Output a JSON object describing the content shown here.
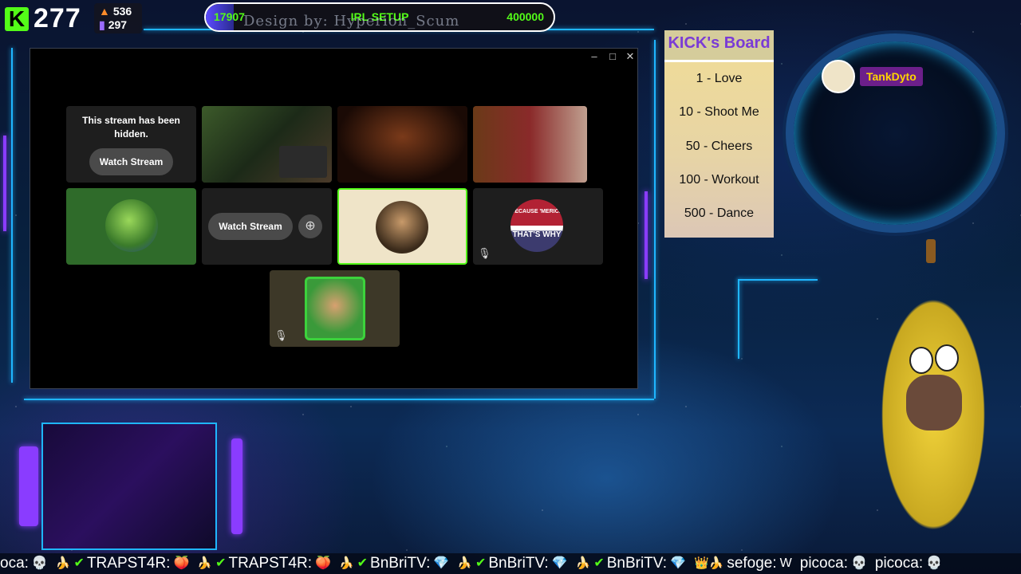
{
  "stats": {
    "viewers": "277",
    "followers": "536",
    "subs": "297"
  },
  "goal": {
    "current": "17907",
    "title": "IRL SETUP",
    "target": "400000",
    "progress": 0.0448,
    "credit": "Design by: Hyperion_Scum"
  },
  "window": {
    "minimize": "–",
    "maximize": "□",
    "close": "✕",
    "tiles": {
      "hidden_message": "This stream has been hidden.",
      "watch_stream": "Watch Stream",
      "watch_stream_2": "Watch Stream",
      "eagle_text_top": "BECAUSE 'MERICA",
      "eagle_text_bottom": "THAT'S WHY"
    }
  },
  "board": {
    "title": "KICK's Board",
    "items": [
      "1 - Love",
      "10 - Shoot Me",
      "50 - Cheers",
      "100 - Workout",
      "500 - Dance"
    ]
  },
  "follower": {
    "name": "TankDyto"
  },
  "ticker": {
    "items": [
      {
        "name": "oca:",
        "emote": "💀",
        "badge": "",
        "verified": false
      },
      {
        "name": "TRAPST4R:",
        "emote": "🍑",
        "badge": "🍌",
        "verified": true
      },
      {
        "name": "TRAPST4R:",
        "emote": "🍑",
        "badge": "🍌",
        "verified": true
      },
      {
        "name": "BnBriTV:",
        "emote": "💎",
        "badge": "🍌",
        "verified": true
      },
      {
        "name": "BnBriTV:",
        "emote": "💎",
        "badge": "🍌",
        "verified": true
      },
      {
        "name": "BnBriTV:",
        "emote": "💎",
        "badge": "🍌",
        "verified": true
      },
      {
        "name": "sefoge:",
        "emote": "W",
        "badge": "👑🍌",
        "verified": false
      },
      {
        "name": "picoca:",
        "emote": "💀",
        "badge": "",
        "verified": false
      },
      {
        "name": "picoca:",
        "emote": "💀",
        "badge": "",
        "verified": false
      }
    ]
  },
  "colors": {
    "kick_green": "#53fc18",
    "hud_blue": "#1fb6ff",
    "hud_purple": "#8a3cff",
    "board_title": "#7a3bd6"
  }
}
